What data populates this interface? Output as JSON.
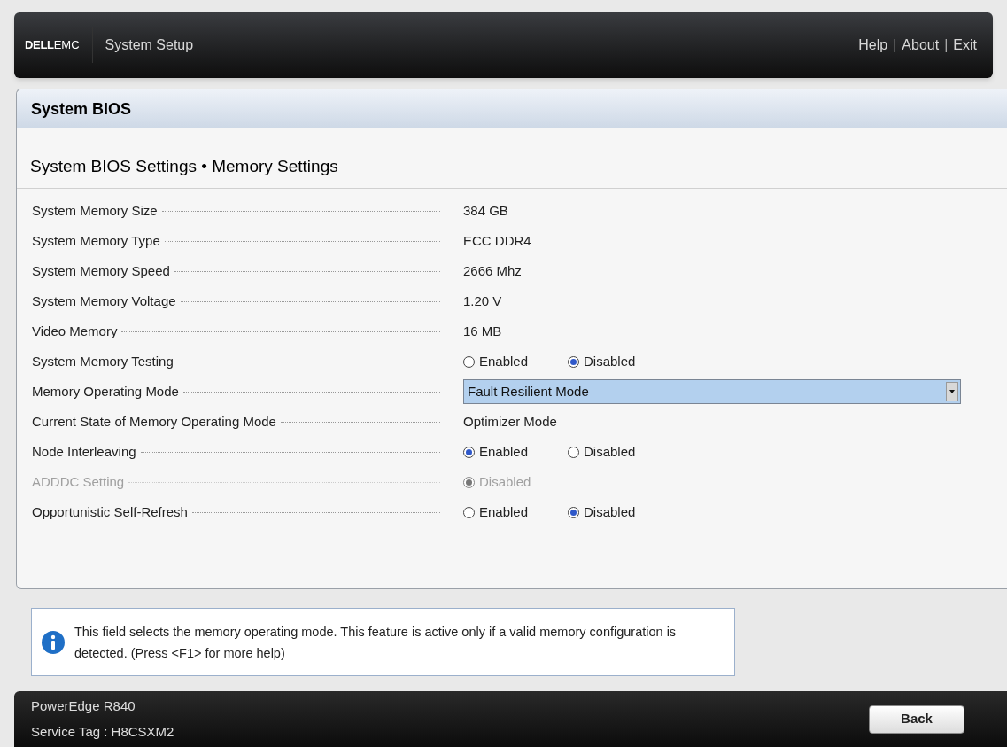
{
  "header": {
    "brand": {
      "bold": "DELL",
      "light": "EMC"
    },
    "title": "System Setup",
    "links": [
      "Help",
      "About",
      "Exit"
    ],
    "separator": "|"
  },
  "panel": {
    "title": "System BIOS",
    "subtitle": "System BIOS Settings • Memory Settings"
  },
  "settings": [
    {
      "label": "System Memory Size",
      "kind": "value",
      "disabled": false,
      "value": "384 GB"
    },
    {
      "label": "System Memory Type",
      "kind": "value",
      "disabled": false,
      "value": "ECC DDR4"
    },
    {
      "label": "System Memory Speed",
      "kind": "value",
      "disabled": false,
      "value": "2666 Mhz"
    },
    {
      "label": "System Memory Voltage",
      "kind": "value",
      "disabled": false,
      "value": "1.20 V"
    },
    {
      "label": "Video Memory",
      "kind": "value",
      "disabled": false,
      "value": "16 MB"
    },
    {
      "label": "System Memory Testing",
      "kind": "radio",
      "disabled": false,
      "options": [
        {
          "label": "Enabled",
          "selected": false
        },
        {
          "label": "Disabled",
          "selected": true
        }
      ]
    },
    {
      "label": "Memory Operating Mode",
      "kind": "dropdown",
      "disabled": false,
      "value": "Fault Resilient Mode"
    },
    {
      "label": "Current State of Memory Operating Mode",
      "kind": "value",
      "disabled": false,
      "value": "Optimizer Mode"
    },
    {
      "label": "Node Interleaving",
      "kind": "radio",
      "disabled": false,
      "options": [
        {
          "label": "Enabled",
          "selected": true
        },
        {
          "label": "Disabled",
          "selected": false
        }
      ]
    },
    {
      "label": "ADDDC Setting",
      "kind": "radio",
      "disabled": true,
      "options": [
        {
          "label": "Disabled",
          "selected": true
        }
      ]
    },
    {
      "label": "Opportunistic Self-Refresh",
      "kind": "radio",
      "disabled": false,
      "options": [
        {
          "label": "Enabled",
          "selected": false
        },
        {
          "label": "Disabled",
          "selected": true
        }
      ]
    }
  ],
  "help": {
    "text": "This field selects the memory operating mode. This feature is active only if a valid memory configuration is detected. (Press <F1> for more help)"
  },
  "footer": {
    "model": "PowerEdge R840",
    "service_tag": "Service Tag : H8CSXM2",
    "button": "Back"
  }
}
